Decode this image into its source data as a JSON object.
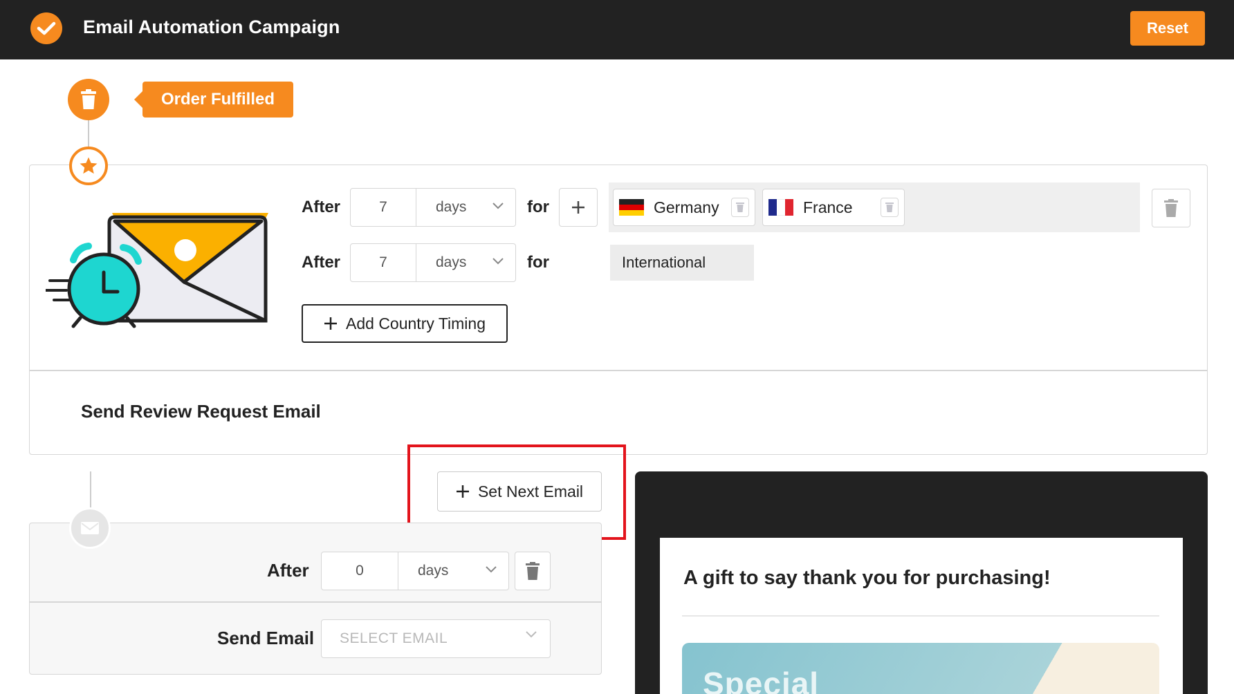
{
  "header": {
    "title": "Email Automation Campaign",
    "reset_label": "Reset",
    "logo_icon": "check-circle-icon"
  },
  "trigger": {
    "label": "Order Fulfilled",
    "icon": "trash-icon"
  },
  "colors": {
    "accent": "#f68a1f",
    "header_bg": "#222222",
    "highlight": "#e3141c"
  },
  "step1": {
    "icon": "star-icon",
    "rows": [
      {
        "after_label": "After",
        "value": "7",
        "unit": "days",
        "for_label": "for",
        "countries": [
          {
            "name": "Germany",
            "flag": "germany-flag"
          },
          {
            "name": "France",
            "flag": "france-flag"
          }
        ]
      },
      {
        "after_label": "After",
        "value": "7",
        "unit": "days",
        "for_label": "for",
        "region": "International"
      }
    ],
    "add_country_label": "Add Country Timing",
    "email_name": "Send Review Request Email"
  },
  "set_next_label": "Set Next Email",
  "step2": {
    "icon": "mail-icon",
    "after_label": "After",
    "value": "0",
    "unit": "days",
    "send_label": "Send Email",
    "select_placeholder": "SELECT EMAIL"
  },
  "preview": {
    "title": "A gift to say thank you for purchasing!",
    "banner_text": "Special"
  }
}
